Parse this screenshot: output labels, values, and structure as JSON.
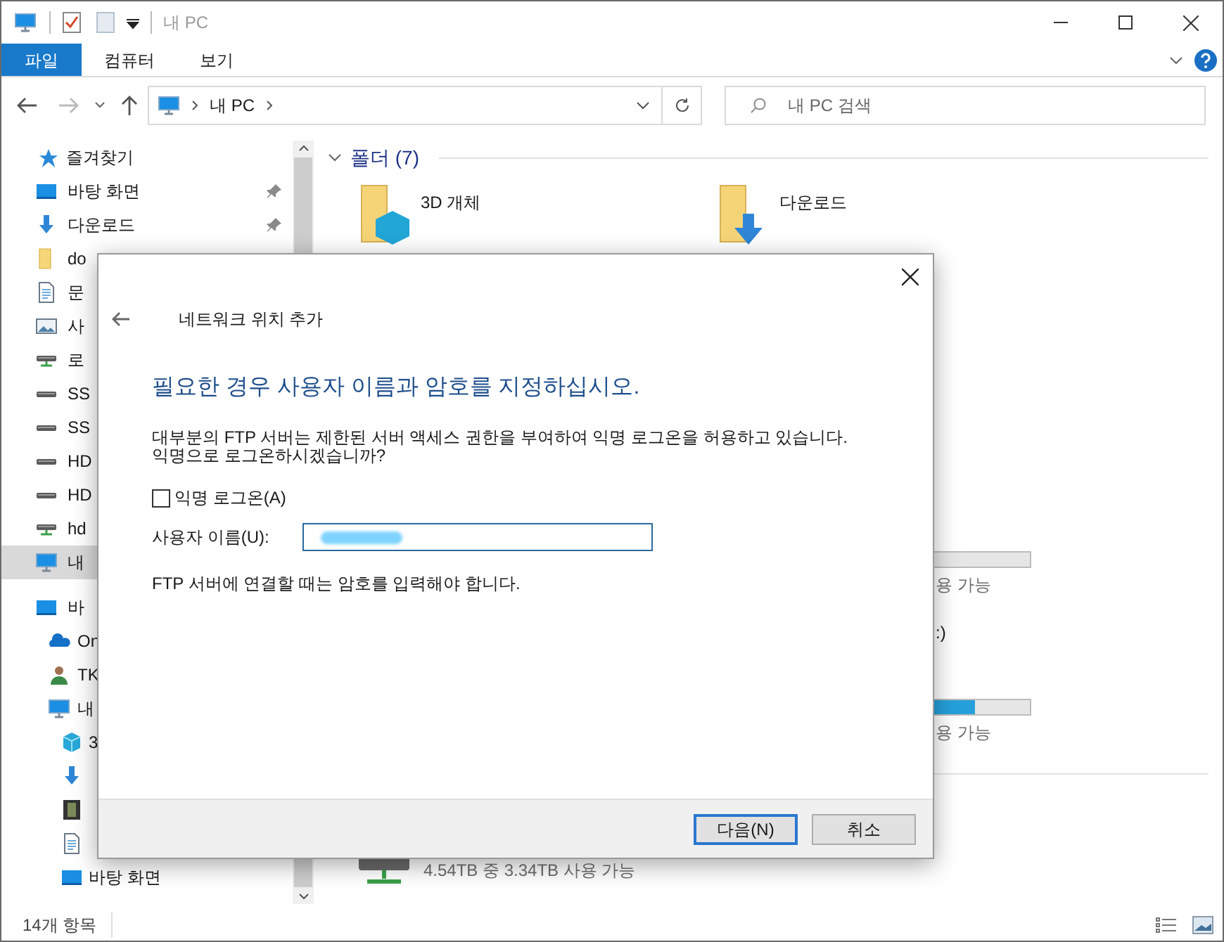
{
  "window": {
    "title": "내 PC"
  },
  "ribbon_tabs": [
    {
      "label": "파일",
      "selected": true
    },
    {
      "label": "컴퓨터",
      "selected": false
    },
    {
      "label": "보기",
      "selected": false
    }
  ],
  "address_bar": {
    "path": "내 PC"
  },
  "search": {
    "placeholder": "내 PC 검색"
  },
  "navigation": {
    "quick_access": {
      "label": "즐겨찾기",
      "items": [
        {
          "label": "바탕 화면",
          "kind": "desktop",
          "pinned": true,
          "selected": false
        },
        {
          "label": "다운로드",
          "kind": "download",
          "pinned": true,
          "selected": false
        },
        {
          "label": "do",
          "kind": "folder",
          "pinned": false,
          "selected": false
        },
        {
          "label": "문",
          "kind": "document",
          "pinned": false,
          "selected": false
        },
        {
          "label": "사",
          "kind": "pictures",
          "pinned": false,
          "selected": false
        },
        {
          "label": "로",
          "kind": "netdrive",
          "pinned": false,
          "selected": false
        },
        {
          "label": "SS",
          "kind": "drive",
          "pinned": false,
          "selected": false
        },
        {
          "label": "SS",
          "kind": "drive",
          "pinned": false,
          "selected": false
        },
        {
          "label": "HD",
          "kind": "drive",
          "pinned": false,
          "selected": false
        },
        {
          "label": "HD",
          "kind": "drive",
          "pinned": false,
          "selected": false
        },
        {
          "label": "hd",
          "kind": "netdrive",
          "pinned": false,
          "selected": false
        },
        {
          "label": "내",
          "kind": "pc",
          "pinned": false,
          "selected": true
        }
      ]
    },
    "tree": [
      {
        "label": "바",
        "kind": "desktop",
        "selected": false,
        "children": [
          {
            "label": "On",
            "kind": "onedrive",
            "selected": false
          },
          {
            "label": "TK",
            "kind": "user",
            "selected": false
          },
          {
            "label": "내",
            "kind": "pc",
            "selected": false,
            "children": [
              {
                "label": "3",
                "kind": "cube",
                "selected": false
              },
              {
                "kind": "download",
                "selected": false
              },
              {
                "kind": "video",
                "selected": false
              },
              {
                "kind": "document",
                "selected": false
              },
              {
                "label": "바탕 화면",
                "kind": "desktop",
                "selected": false
              }
            ]
          }
        ]
      }
    ]
  },
  "folders": {
    "title": "폴더 (7)",
    "items": [
      {
        "label": "3D 개체",
        "kind": "cube"
      },
      {
        "label": "다운로드",
        "kind": "download"
      }
    ]
  },
  "devices": [
    {
      "space": "용 가능"
    },
    {
      "name": ":)",
      "level": 0.79,
      "space": "용 가능"
    }
  ],
  "network_locations": [
    {
      "kind": "netdrive",
      "space": "4.54TB 중 3.34TB 사용 가능"
    }
  ],
  "status_bar": {
    "count": "14개 항목"
  },
  "dialog": {
    "title": "네트워크 위치 추가",
    "heading": "필요한 경우 사용자 이름과 암호를 지정하십시오.",
    "description": "대부분의 FTP 서버는 제한된 서버 액세스 권한을 부여하여 익명 로그온을 허용하고 있습니다.\n익명으로 로그온하시겠습니까?",
    "anonymous_login": {
      "label": "익명 로그온(A)",
      "checked": false
    },
    "username": {
      "label": "사용자 이름(U):"
    },
    "note": "FTP 서버에 연결할 때는 암호를 입력해야 합니다.",
    "buttons": [
      {
        "label": "다음(N)",
        "default": true
      },
      {
        "label": "취소",
        "default": false
      }
    ]
  }
}
